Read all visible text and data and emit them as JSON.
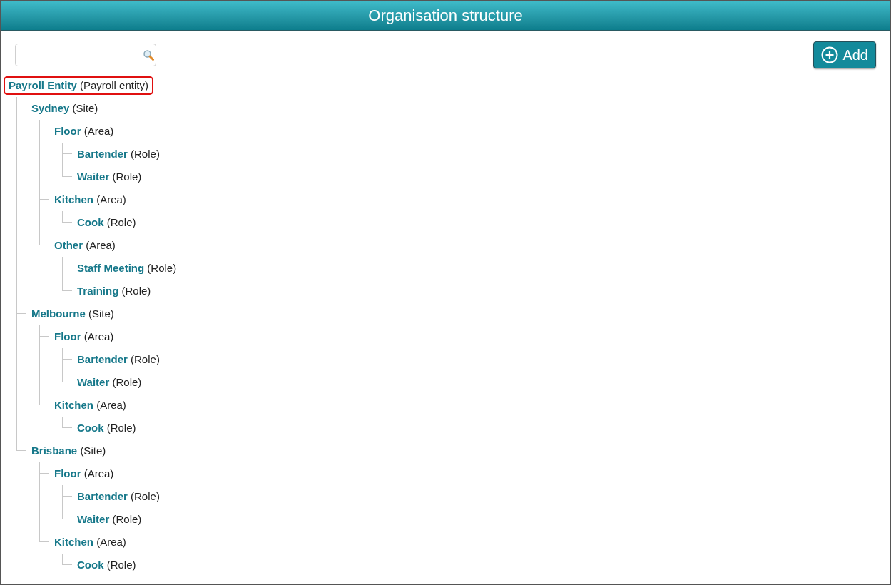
{
  "window": {
    "title": "Organisation structure"
  },
  "add_button": {
    "label": "Add"
  },
  "tree": {
    "name": "Payroll Entity",
    "type": "(Payroll entity)",
    "selected": true,
    "children": [
      {
        "name": "Sydney",
        "type": "(Site)",
        "selected": false,
        "children": [
          {
            "name": "Floor",
            "type": "(Area)",
            "selected": false,
            "children": [
              {
                "name": "Bartender",
                "type": "(Role)",
                "selected": false
              },
              {
                "name": "Waiter",
                "type": "(Role)",
                "selected": false
              }
            ]
          },
          {
            "name": "Kitchen",
            "type": "(Area)",
            "selected": false,
            "children": [
              {
                "name": "Cook",
                "type": "(Role)",
                "selected": false
              }
            ]
          },
          {
            "name": "Other",
            "type": "(Area)",
            "selected": false,
            "children": [
              {
                "name": "Staff Meeting",
                "type": "(Role)",
                "selected": false
              },
              {
                "name": "Training",
                "type": "(Role)",
                "selected": false
              }
            ]
          }
        ]
      },
      {
        "name": "Melbourne",
        "type": "(Site)",
        "selected": false,
        "children": [
          {
            "name": "Floor",
            "type": "(Area)",
            "selected": false,
            "children": [
              {
                "name": "Bartender",
                "type": "(Role)",
                "selected": false
              },
              {
                "name": "Waiter",
                "type": "(Role)",
                "selected": false
              }
            ]
          },
          {
            "name": "Kitchen",
            "type": "(Area)",
            "selected": false,
            "children": [
              {
                "name": "Cook",
                "type": "(Role)",
                "selected": false
              }
            ]
          }
        ]
      },
      {
        "name": "Brisbane",
        "type": "(Site)",
        "selected": false,
        "children": [
          {
            "name": "Floor",
            "type": "(Area)",
            "selected": false,
            "children": [
              {
                "name": "Bartender",
                "type": "(Role)",
                "selected": false
              },
              {
                "name": "Waiter",
                "type": "(Role)",
                "selected": false
              }
            ]
          },
          {
            "name": "Kitchen",
            "type": "(Area)",
            "selected": false,
            "children": [
              {
                "name": "Cook",
                "type": "(Role)",
                "selected": false
              }
            ]
          }
        ]
      }
    ]
  }
}
